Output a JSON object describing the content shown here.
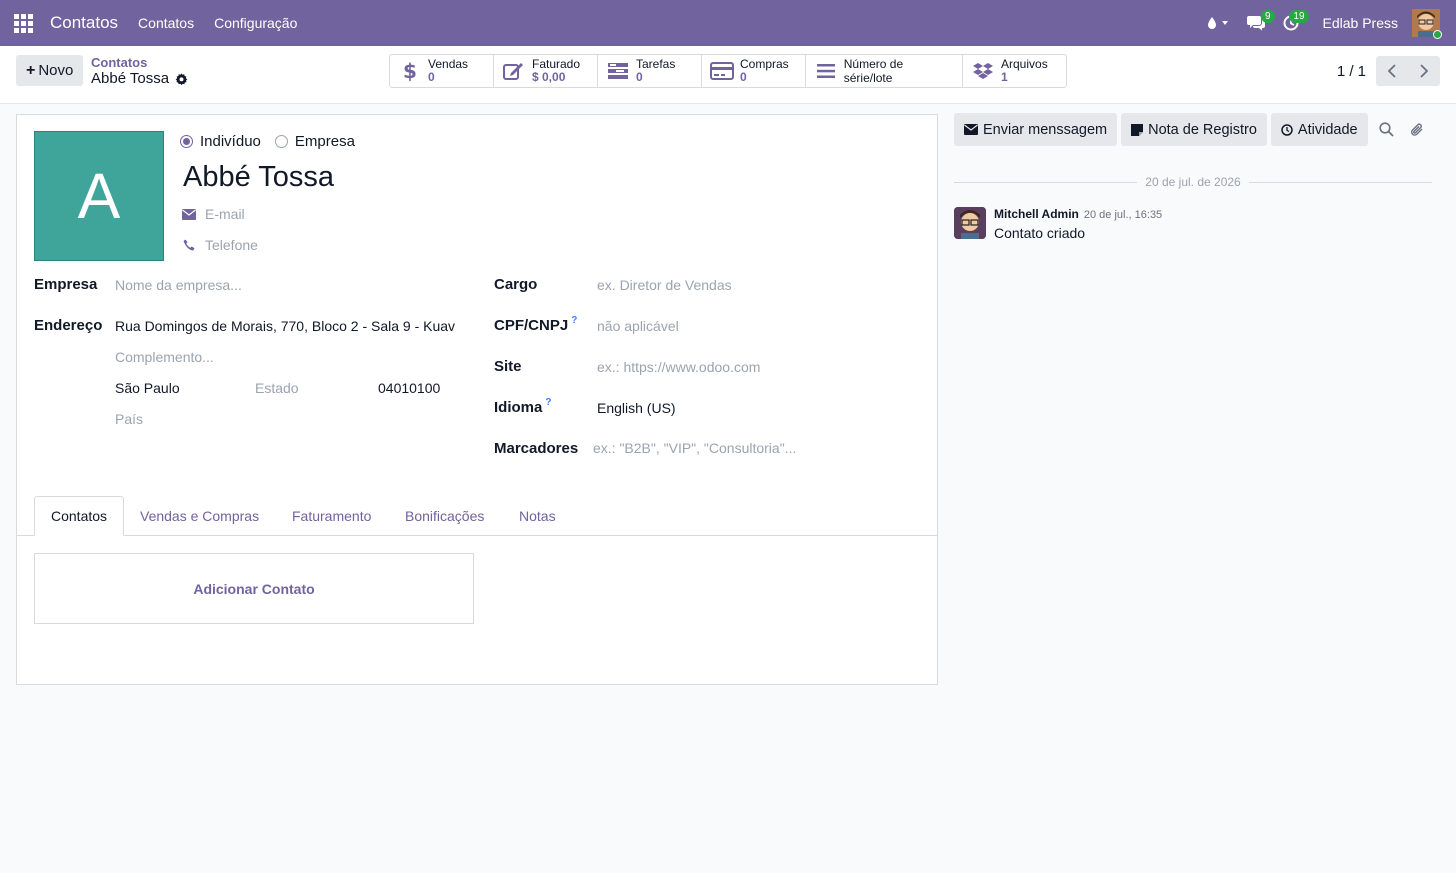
{
  "navbar": {
    "brand": "Contatos",
    "menus": [
      "Contatos",
      "Configuração"
    ],
    "messages_badge": "9",
    "activities_badge": "19",
    "company": "Edlab Press"
  },
  "control_panel": {
    "new_label": "Novo",
    "breadcrumb_parent": "Contatos",
    "breadcrumb_current": "Abbé Tossa",
    "smart_buttons": [
      {
        "label": "Vendas",
        "value": "0"
      },
      {
        "label": "Faturado",
        "value": "$ 0,00"
      },
      {
        "label": "Tarefas",
        "value": "0"
      },
      {
        "label": "Compras",
        "value": "0"
      },
      {
        "label": "Número de série/lote"
      },
      {
        "label": "Arquivos",
        "value": "1"
      }
    ],
    "pager": "1 / 1"
  },
  "form": {
    "avatar_letter": "A",
    "type_individual": "Indivíduo",
    "type_company": "Empresa",
    "name": "Abbé Tossa",
    "email_placeholder": "E-mail",
    "phone_placeholder": "Telefone",
    "company_label": "Empresa",
    "company_placeholder": "Nome da empresa...",
    "address_label": "Endereço",
    "street": "Rua Domingos de Morais, 770, Bloco 2 - Sala 9 - Kuav",
    "street2_placeholder": "Complemento...",
    "city": "São Paulo",
    "state_placeholder": "Estado",
    "zip": "04010100",
    "country_placeholder": "País",
    "job_label": "Cargo",
    "job_placeholder": "ex. Diretor de Vendas",
    "vat_label": "CPF/CNPJ",
    "vat_placeholder": "não aplicável",
    "site_label": "Site",
    "site_placeholder": "ex.: https://www.odoo.com",
    "lang_label": "Idioma",
    "lang_value": "English (US)",
    "tags_label": "Marcadores",
    "tags_placeholder": "ex.: \"B2B\", \"VIP\", \"Consultoria\"...",
    "help_mark": "?"
  },
  "tabs": [
    "Contatos",
    "Vendas e Compras",
    "Faturamento",
    "Bonificações",
    "Notas"
  ],
  "add_contact_label": "Adicionar Contato",
  "chatter": {
    "send_message": "Enviar menssagem",
    "log_note": "Nota de Registro",
    "activity": "Atividade",
    "date_separator": "20 de jul. de 2026",
    "message": {
      "author": "Mitchell Admin",
      "date": "20 de jul., 16:35",
      "body": "Contato criado"
    }
  },
  "colors": {
    "primary": "#71639e",
    "avatar": "#3fa59a",
    "badge": "#28a745"
  }
}
